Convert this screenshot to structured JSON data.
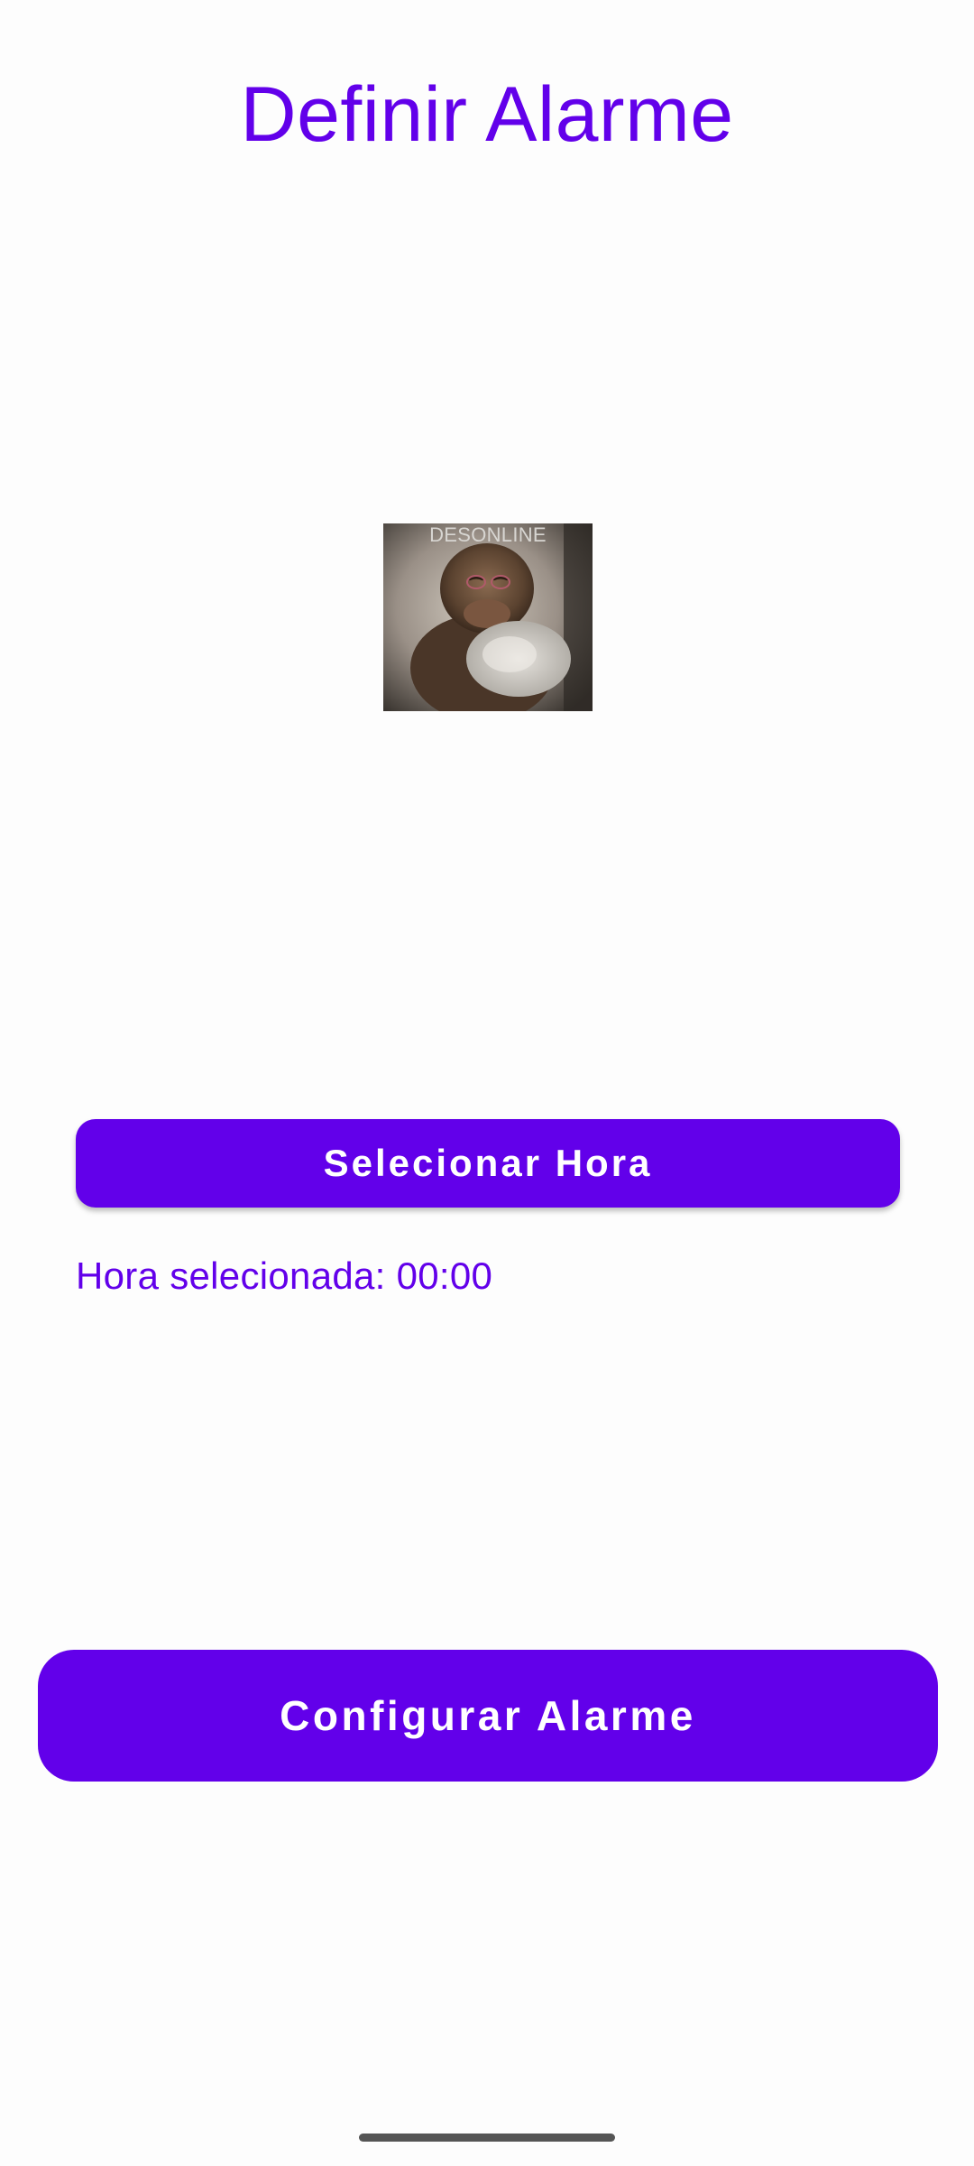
{
  "header": {
    "title": "Definir Alarme"
  },
  "image": {
    "icon": "sleeping-monkey-image",
    "caption": "DESONLINE"
  },
  "time_picker": {
    "button_label": "Selecionar Hora",
    "selected_text": "Hora selecionada: 00:00"
  },
  "actions": {
    "configure_label": "Configurar Alarme"
  },
  "colors": {
    "accent": "#6200ea",
    "background": "#fdfdfd",
    "button_text": "#ffffff"
  }
}
